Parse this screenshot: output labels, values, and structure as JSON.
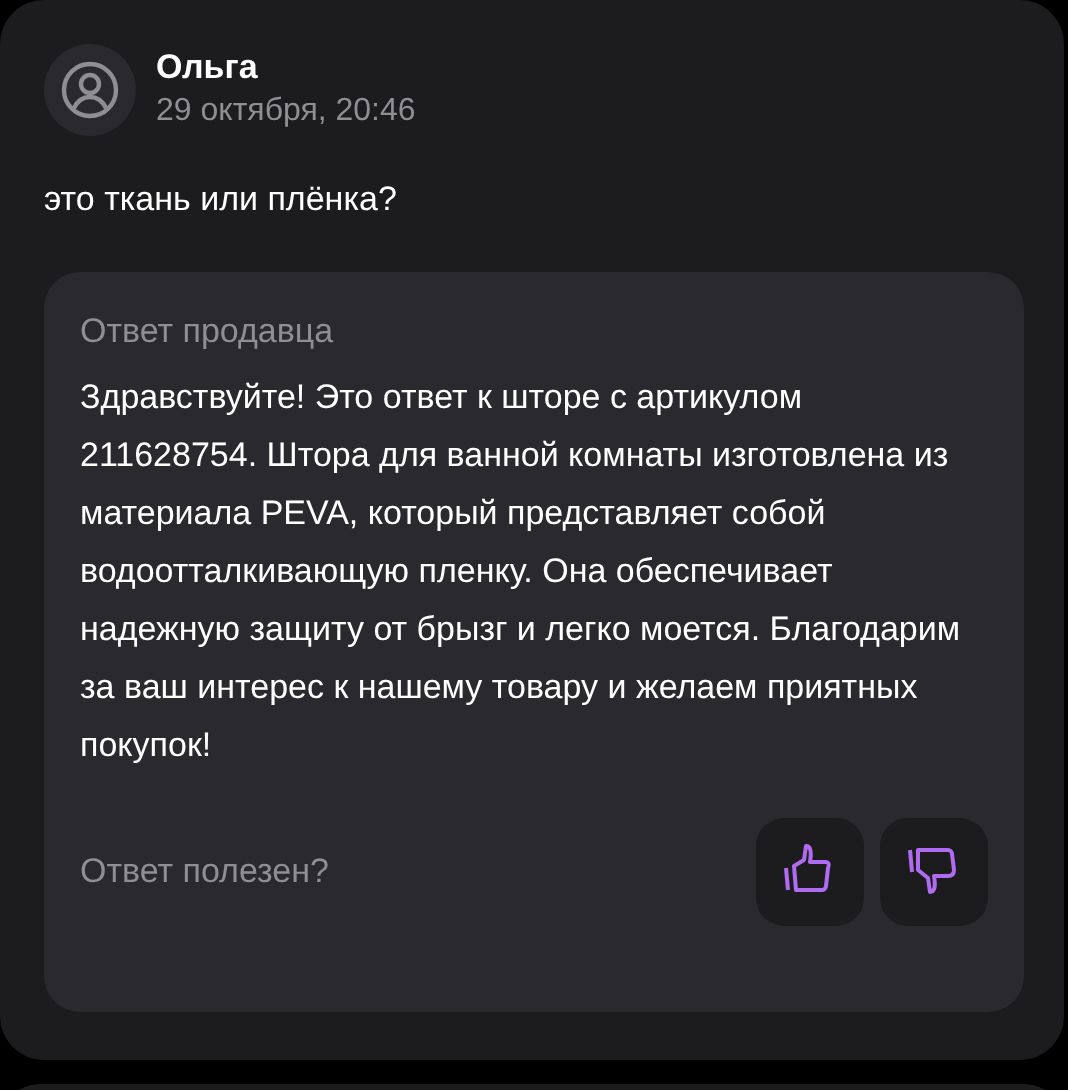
{
  "review": {
    "author": "Ольга",
    "date": "29 октября, 20:46",
    "text": "это ткань или плёнка?",
    "seller_reply": {
      "title": "Ответ продавца",
      "text": "Здравствуйте! Это ответ к шторе с артикулом 211628754. Штора для ванной комнаты изготовлена из материала PEVA, который представляет собой водоотталкивающую пленку. Она обеспечивает надежную защиту от брызг и легко моется. Благодарим за ваш интерес к нашему товару и желаем приятных покупок!",
      "helpful_prompt": "Ответ полезен?"
    }
  }
}
